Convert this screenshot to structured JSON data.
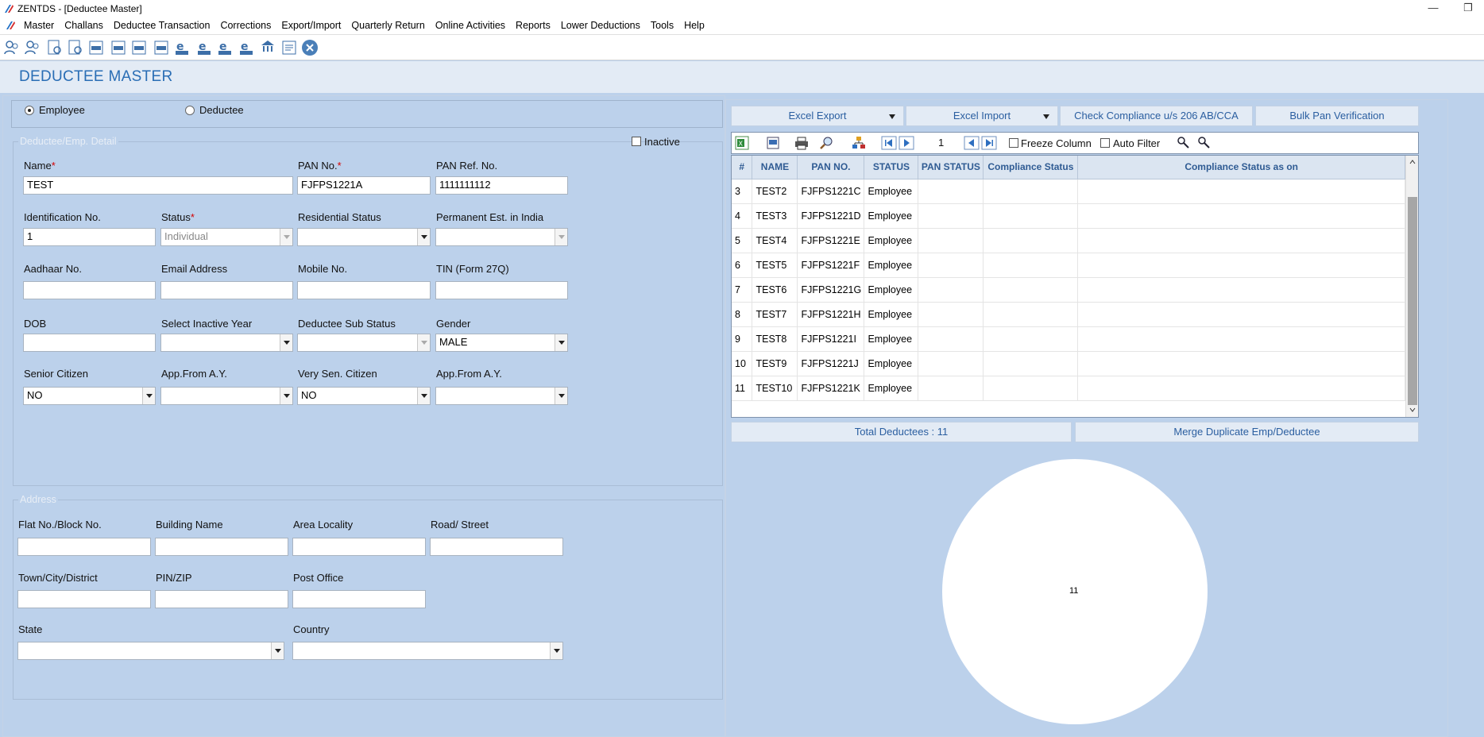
{
  "window": {
    "title": "ZENTDS - [Deductee Master]"
  },
  "menu": [
    "Master",
    "Challans",
    "Deductee Transaction",
    "Corrections",
    "Export/Import",
    "Quarterly Return",
    "Online Activities",
    "Reports",
    "Lower Deductions",
    "Tools",
    "Help"
  ],
  "toolbar_icons": [
    "users-icon",
    "group-icon",
    "user-doc-icon",
    "user-doc-2-icon",
    "form-24q-icon",
    "form-26q-icon",
    "form-27q-icon",
    "form-27eq-icon",
    "e-24q-icon",
    "e-26q-icon",
    "e-27q-icon",
    "e-27eq-icon",
    "tds-icon",
    "report-icon",
    "close-icon"
  ],
  "page_title": "DEDUCTEE MASTER",
  "type_selector": {
    "employee": "Employee",
    "deductee": "Deductee",
    "selected": "Employee"
  },
  "detail": {
    "legend": "Deductee/Emp. Detail",
    "inactive_label": "Inactive",
    "name_label": "Name",
    "name_value": "TEST",
    "pan_label": "PAN No.",
    "pan_value": "FJFPS1221A",
    "panref_label": "PAN Ref. No.",
    "panref_value": "1111111112",
    "idno_label": "Identification No.",
    "idno_value": "1",
    "status_label": "Status",
    "status_value": "Individual",
    "resstatus_label": "Residential Status",
    "permest_label": "Permanent Est. in India",
    "aadhaar_label": "Aadhaar No.",
    "email_label": "Email Address",
    "mobile_label": "Mobile No.",
    "tin_label": "TIN (Form 27Q)",
    "dob_label": "DOB",
    "inactiveyear_label": "Select Inactive Year",
    "substatus_label": "Deductee Sub Status",
    "gender_label": "Gender",
    "gender_value": "MALE",
    "senior_label": "Senior Citizen",
    "senior_value": "NO",
    "appfrom1_label": "App.From A.Y.",
    "verysenior_label": "Very Sen. Citizen",
    "verysenior_value": "NO",
    "appfrom2_label": "App.From A.Y."
  },
  "address": {
    "legend": "Address",
    "flat_label": "Flat No./Block No.",
    "building_label": "Building Name",
    "area_label": "Area Locality",
    "road_label": "Road/ Street",
    "town_label": "Town/City/District",
    "pin_label": "PIN/ZIP",
    "post_label": "Post Office",
    "state_label": "State",
    "country_label": "Country"
  },
  "actions": {
    "excel_export": "Excel Export",
    "excel_import": "Excel Import",
    "check_compliance": "Check Compliance u/s 206 AB/CCA",
    "bulk_pan": "Bulk Pan Verification",
    "page_number": "1",
    "freeze_column": "Freeze Column",
    "auto_filter": "Auto Filter",
    "total_deductees": "Total Deductees : 11",
    "merge_duplicate": "Merge Duplicate Emp/Deductee"
  },
  "grid": {
    "columns": [
      "#",
      "NAME",
      "PAN NO.",
      "STATUS",
      "PAN STATUS",
      "Compliance Status",
      "Compliance Status as on"
    ],
    "rows": [
      [
        "3",
        "TEST2",
        "FJFPS1221C",
        "Employee"
      ],
      [
        "4",
        "TEST3",
        "FJFPS1221D",
        "Employee"
      ],
      [
        "5",
        "TEST4",
        "FJFPS1221E",
        "Employee"
      ],
      [
        "6",
        "TEST5",
        "FJFPS1221F",
        "Employee"
      ],
      [
        "7",
        "TEST6",
        "FJFPS1221G",
        "Employee"
      ],
      [
        "8",
        "TEST7",
        "FJFPS1221H",
        "Employee"
      ],
      [
        "9",
        "TEST8",
        "FJFPS1221I",
        "Employee"
      ],
      [
        "10",
        "TEST9",
        "FJFPS1221J",
        "Employee"
      ],
      [
        "11",
        "TEST10",
        "FJFPS1221K",
        "Employee"
      ]
    ]
  },
  "chart_data": {
    "type": "pie",
    "values": [
      11
    ],
    "labels": [
      "11"
    ]
  },
  "colors": {
    "background": "#bcd1eb",
    "accent": "#2a6eb5",
    "button_text": "#2a5ea0"
  }
}
